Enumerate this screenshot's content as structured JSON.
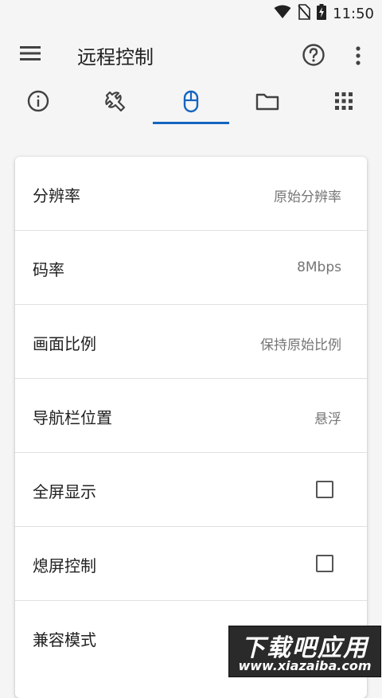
{
  "status_bar": {
    "time": "11:50",
    "icons": [
      "wifi-icon",
      "no-sim-icon",
      "battery-charging-icon"
    ]
  },
  "app_bar": {
    "title": "远程控制",
    "icons": [
      "menu-icon",
      "help-icon",
      "more-vert-icon"
    ]
  },
  "tabs": [
    {
      "icon": "info-icon",
      "selected": false
    },
    {
      "icon": "wrench-icon",
      "selected": false
    },
    {
      "icon": "mouse-icon",
      "selected": true
    },
    {
      "icon": "folder-icon",
      "selected": false
    },
    {
      "icon": "apps-grid-icon",
      "selected": false
    }
  ],
  "colors": {
    "accent": "#1565c0",
    "background": "#f5f5f5",
    "card": "#ffffff",
    "secondary_text": "#757575"
  },
  "settings": {
    "rows": [
      {
        "label": "分辨率",
        "value": "原始分辨率"
      },
      {
        "label": "码率",
        "value": "8Mbps"
      },
      {
        "label": "画面比例",
        "value": "保持原始比例"
      },
      {
        "label": "导航栏位置",
        "value": "悬浮"
      },
      {
        "label": "全屏显示",
        "checked": false
      },
      {
        "label": "熄屏控制",
        "checked": false
      },
      {
        "label": "兼容模式",
        "checked": false
      }
    ]
  },
  "watermark": {
    "title": "下载吧应用",
    "url": "www.xiazaiba.com"
  }
}
